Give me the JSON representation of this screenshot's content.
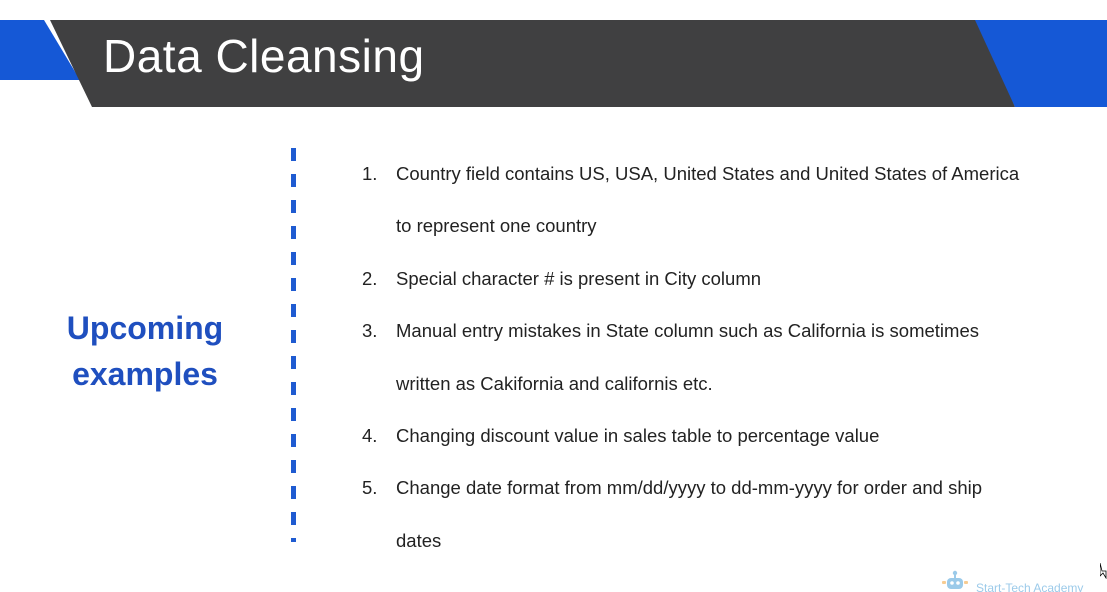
{
  "slide": {
    "title": "Data Cleansing",
    "side_heading": {
      "line1": "Upcoming",
      "line2": "examples"
    },
    "items": [
      {
        "number": "1.",
        "line1": "Country field contains US, USA, United States and United States of America",
        "line2": "to represent one country"
      },
      {
        "number": "2.",
        "line1": "Special character # is present in City column"
      },
      {
        "number": "3.",
        "line1": "Manual entry mistakes in State column such as California is sometimes",
        "line2": "written as Cakifornia and californis etc."
      },
      {
        "number": "4.",
        "line1": "Changing discount value in sales table to percentage value"
      },
      {
        "number": "5.",
        "line1": "Change date format from mm/dd/yyyy to dd-mm-yyyy for order and ship",
        "line2": "dates"
      }
    ],
    "logo": {
      "text": "Start-Tech Academy",
      "icon": "robot-logo-icon"
    }
  },
  "colors": {
    "header_bar": "#404041",
    "accent_blue": "#1558d6",
    "heading_blue": "#1f4fbf",
    "divider_blue": "#1f5bd1",
    "body_text": "#222222"
  }
}
